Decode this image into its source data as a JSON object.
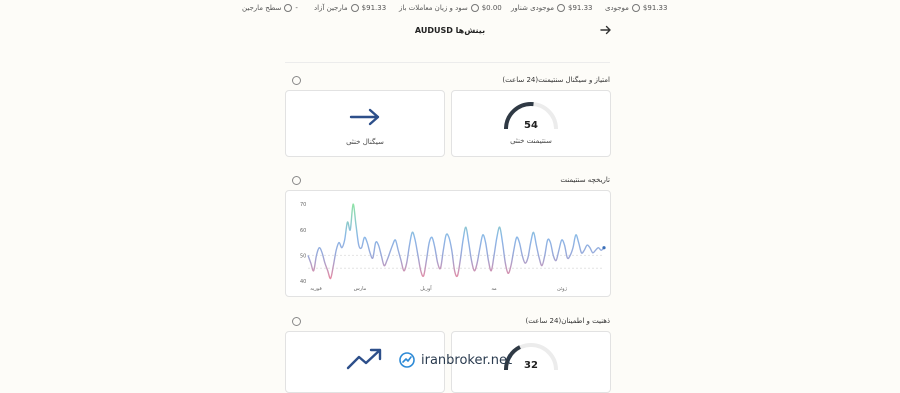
{
  "topbar": {
    "balance": {
      "label": "موجودی",
      "value": "$91.33"
    },
    "floating_balance": {
      "label": "موجودی شناور",
      "value": "$91.33"
    },
    "unrealized_pl": {
      "label": "سود و زیان معاملات باز",
      "value": "$0.00"
    },
    "free_margin": {
      "label": "مارجین آزاد",
      "value": "$91.33"
    },
    "margin_level": {
      "label": "سطح مارجین",
      "value": "-"
    }
  },
  "header": {
    "title": "AUDUSD بینش‌ها"
  },
  "sentiment_section": {
    "title": "امتیاز و سیگنال سنتیمنت(24 ساعت)",
    "gauge_value": "54",
    "gauge_label": "سنتیمنت خنثی",
    "signal_label": "سیگنال خنثی"
  },
  "history_section": {
    "title": "تاریخچه سنتیمنت"
  },
  "mindset_section": {
    "title": "ذهنیت و اطمینان(24 ساعت)",
    "gauge_value": "32"
  },
  "watermark": {
    "text": "iranbroker.net"
  },
  "chart_data": {
    "type": "line",
    "title": "",
    "xlabel": "",
    "ylabel": "",
    "ylim": [
      40,
      72
    ],
    "yticks": [
      "70",
      "60",
      "50",
      "40"
    ],
    "xticks": [
      "فوریه",
      "مارس",
      "آوریل",
      "مه",
      "ژوئن"
    ],
    "grid": false,
    "values": [
      50,
      47,
      44,
      50,
      53,
      51,
      47,
      44,
      41,
      46,
      52,
      55,
      53,
      56,
      63,
      60,
      70,
      62,
      54,
      53,
      57,
      55,
      51,
      49,
      55,
      54,
      50,
      46,
      48,
      51,
      54,
      56,
      52,
      48,
      44,
      47,
      54,
      59,
      56,
      50,
      44,
      42,
      48,
      55,
      57,
      53,
      47,
      45,
      52,
      58,
      57,
      52,
      44,
      42,
      48,
      56,
      61,
      55,
      48,
      44,
      47,
      53,
      58,
      55,
      48,
      44,
      50,
      57,
      61,
      55,
      47,
      43,
      46,
      52,
      57,
      55,
      50,
      47,
      49,
      55,
      59,
      54,
      49,
      46,
      50,
      56,
      55,
      50,
      48,
      52,
      56,
      54,
      49,
      50,
      53,
      58,
      55,
      51,
      52,
      54,
      53,
      51,
      52,
      53,
      52,
      53
    ]
  }
}
